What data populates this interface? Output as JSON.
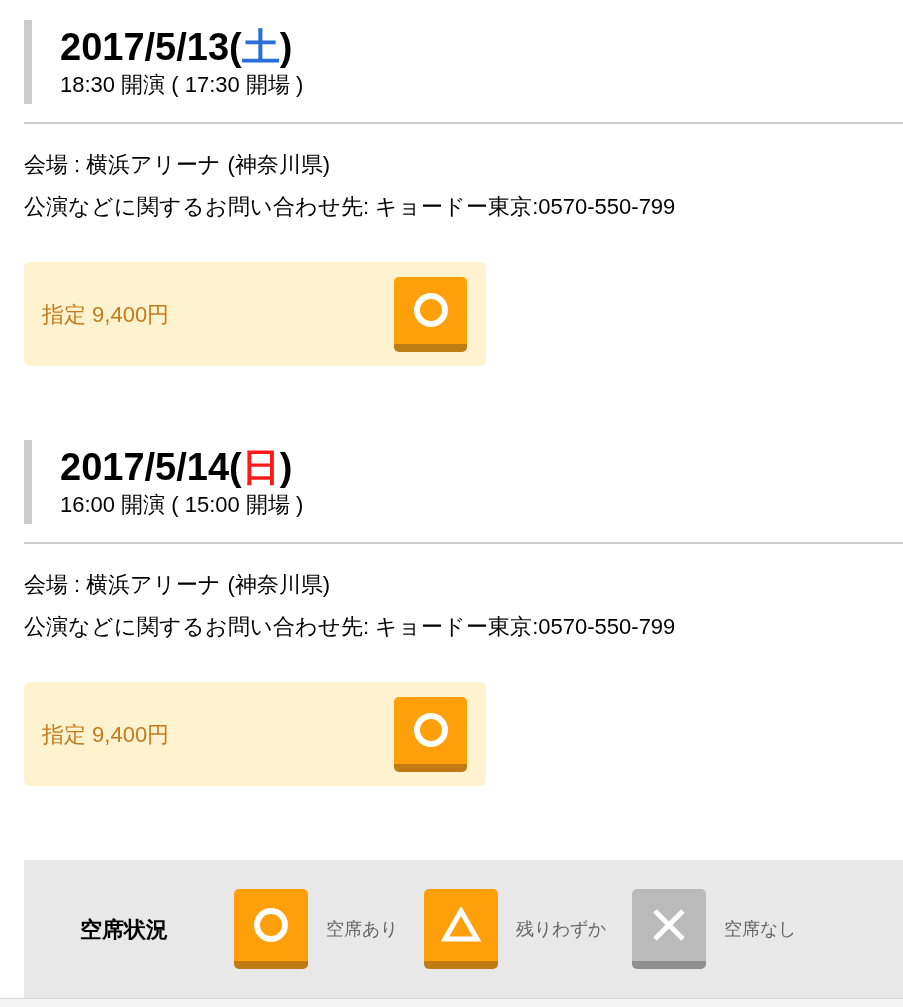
{
  "performances": [
    {
      "date": "2017/5/13(",
      "weekday": {
        "text": "土",
        "color": "#2b6fd6"
      },
      "date_end": ")",
      "time": "18:30 開演 ( 17:30 開場 )",
      "venue": "会場 : 横浜アリーナ (神奈川県)",
      "contact": "公演などに関するお問い合わせ先: キョードー東京:0570-550-799",
      "tickets": [
        {
          "label": "指定 9,400円",
          "kind": "available"
        }
      ]
    },
    {
      "date": "2017/5/14(",
      "weekday": {
        "text": "日",
        "color": "#ff1a1a"
      },
      "date_end": ")",
      "time": "16:00 開演 ( 15:00 開場 )",
      "venue": "会場 : 横浜アリーナ (神奈川県)",
      "contact": "公演などに関するお問い合わせ先: キョードー東京:0570-550-799",
      "tickets": [
        {
          "label": "指定 9,400円",
          "kind": "available"
        }
      ]
    }
  ],
  "legend": {
    "title": "空席状況",
    "items": [
      {
        "kind": "available",
        "label": "空席あり"
      },
      {
        "kind": "few",
        "label": "残りわずか"
      },
      {
        "kind": "none",
        "label": "空席なし"
      }
    ]
  }
}
